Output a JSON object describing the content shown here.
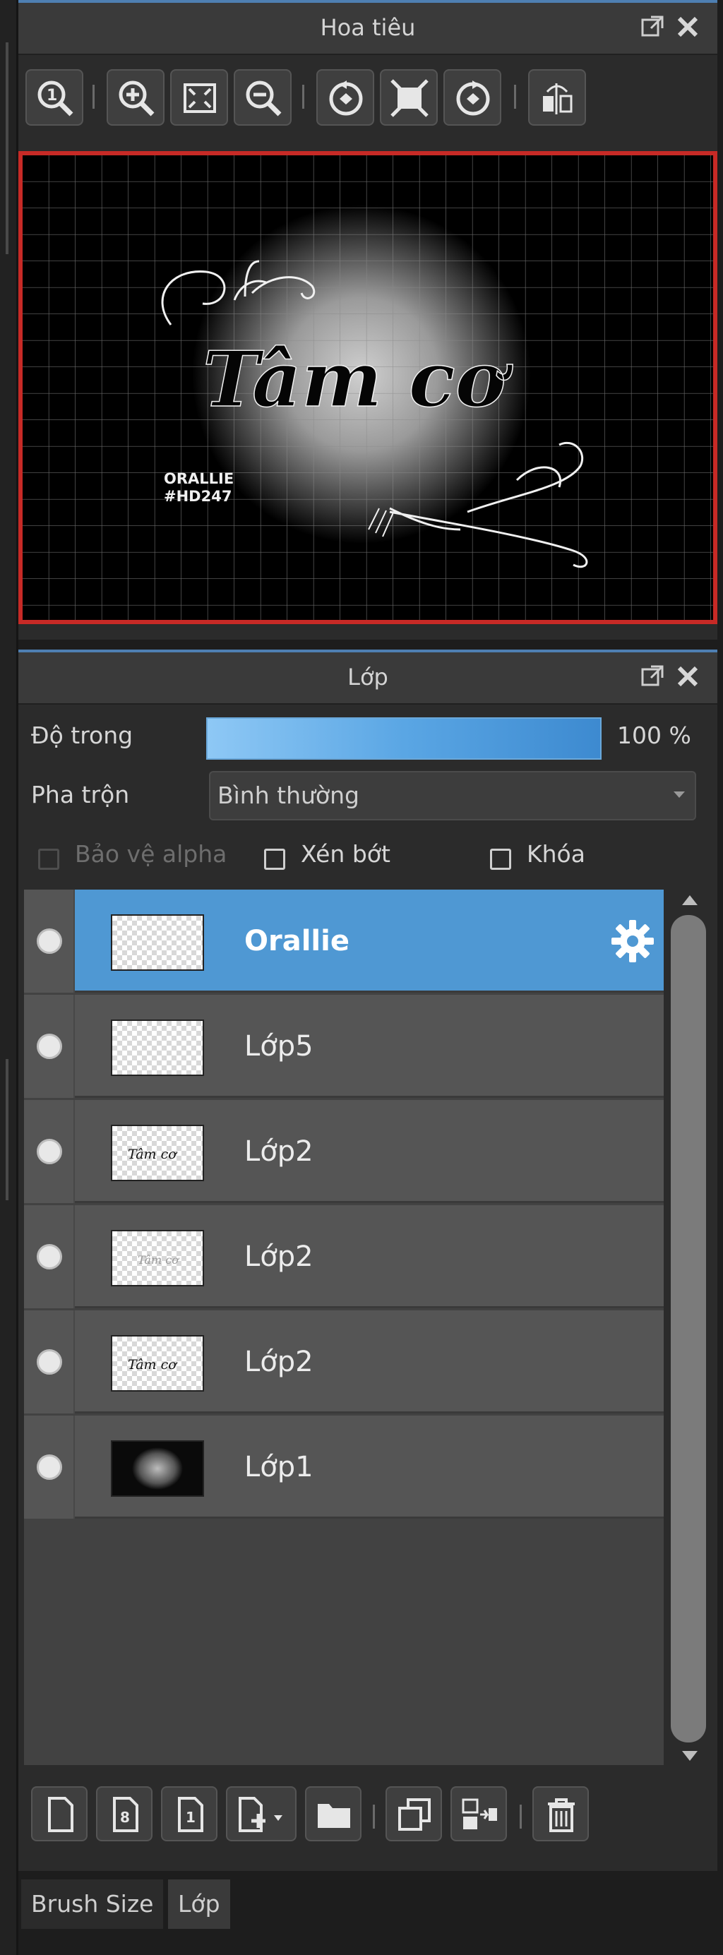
{
  "navigator": {
    "title": "Hoa tiêu",
    "toolbar_icons": [
      "zoom-actual-icon",
      "zoom-in-icon",
      "fit-screen-icon",
      "zoom-out-icon",
      "rotate-left-icon",
      "fit-window-icon",
      "rotate-right-icon",
      "flip-horizontal-icon"
    ],
    "canvas_preview": {
      "main_text": "Tâm cơ",
      "small_text_line1": "ORALLIE",
      "small_text_line2": "#HD247"
    }
  },
  "layer_panel": {
    "title": "Lớp",
    "opacity_label": "Độ trong",
    "opacity_value": "100 %",
    "opacity_fraction": 1.0,
    "blend_label": "Pha trộn",
    "blend_value": "Bình thường",
    "checkboxes": [
      {
        "label": "Bảo vệ alpha",
        "checked": false,
        "enabled": false
      },
      {
        "label": "Xén bớt",
        "checked": false,
        "enabled": true
      },
      {
        "label": "Khóa",
        "checked": false,
        "enabled": true
      }
    ],
    "layers": [
      {
        "name": "Orallie",
        "selected": true,
        "visible": true
      },
      {
        "name": "Lớp5",
        "selected": false,
        "visible": true
      },
      {
        "name": "Lớp2",
        "selected": false,
        "visible": true
      },
      {
        "name": "Lớp2",
        "selected": false,
        "visible": true
      },
      {
        "name": "Lớp2",
        "selected": false,
        "visible": true
      },
      {
        "name": "Lớp1",
        "selected": false,
        "visible": true
      }
    ],
    "layer_thumb_texts": [
      "Tâm cơ",
      "Tâm cơ",
      "Tâm cơ"
    ],
    "bottom_toolbar_icons": [
      "new-layer-icon",
      "new-8bit-layer-icon",
      "new-1bit-layer-icon",
      "add-layer-menu-icon",
      "new-folder-icon",
      "duplicate-layer-icon",
      "merge-down-icon",
      "delete-layer-icon"
    ]
  },
  "bottom_tabs": [
    {
      "label": "Brush Size",
      "active": false
    },
    {
      "label": "Lớp",
      "active": true
    }
  ],
  "colors": {
    "accent_blue": "#4f98d3",
    "preview_border_red": "#c72a26",
    "panel_bg": "#2b2b2b"
  }
}
